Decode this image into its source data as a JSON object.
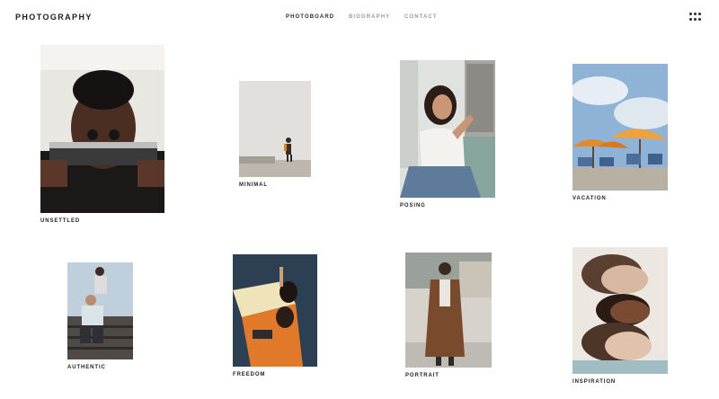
{
  "brand": "PHOTOGRAPHY",
  "nav": {
    "items": [
      {
        "label": "PHOTOBOARD",
        "active": true
      },
      {
        "label": "BIOGRAPHY",
        "active": false
      },
      {
        "label": "CONTACT",
        "active": false
      }
    ]
  },
  "menu_icon": "grid-dots-icon",
  "gallery": [
    {
      "caption": "UNSETTLED",
      "subject": "man with mirror"
    },
    {
      "caption": "MINIMAL",
      "subject": "walker on wall"
    },
    {
      "caption": "POSING",
      "subject": "woman by window"
    },
    {
      "caption": "VACATION",
      "subject": "beach umbrellas"
    },
    {
      "caption": "AUTHENTIC",
      "subject": "two men on stairs"
    },
    {
      "caption": "FREEDOM",
      "subject": "two people lying"
    },
    {
      "caption": "PORTRAIT",
      "subject": "man in coat"
    },
    {
      "caption": "INSPIRATION",
      "subject": "three faces"
    }
  ]
}
